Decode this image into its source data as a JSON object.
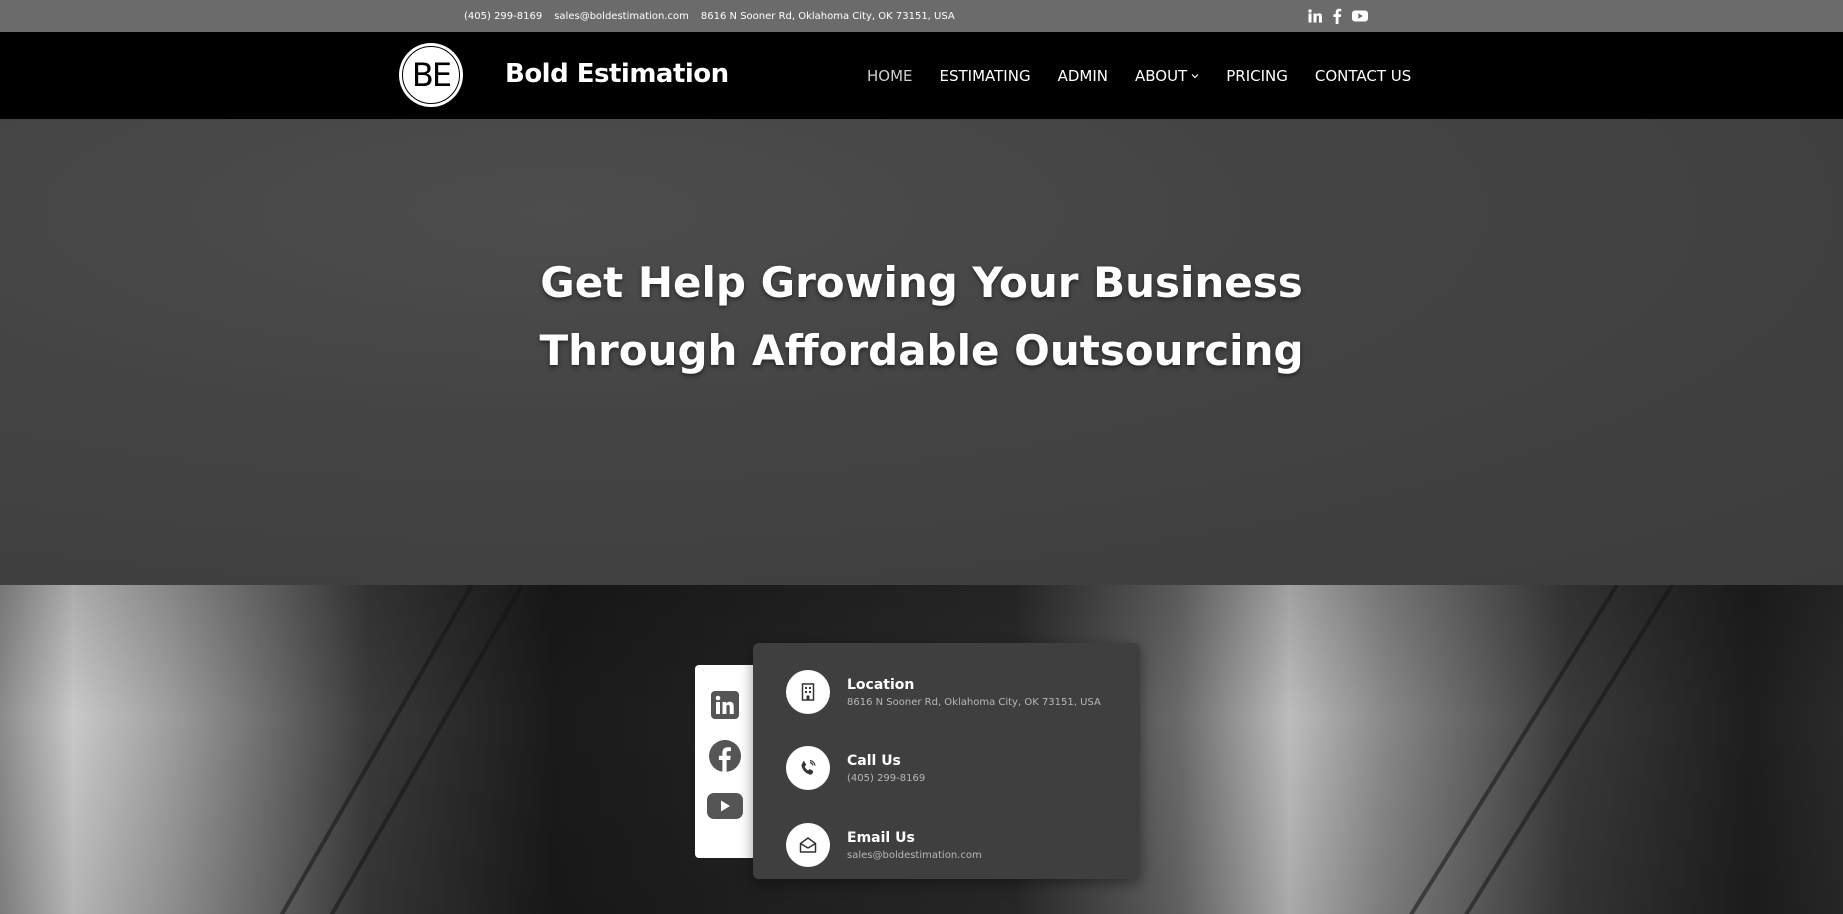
{
  "topbar": {
    "phone": "(405) 299-8169",
    "email": "sales@boldestimation.com",
    "address": "8616 N Sooner Rd, Oklahoma City, OK 73151, USA",
    "socials": [
      "linkedin-icon",
      "facebook-icon",
      "youtube-icon"
    ]
  },
  "header": {
    "logo_text": "BE",
    "brand": "Bold Estimation",
    "nav": [
      {
        "label": "HOME",
        "active": true
      },
      {
        "label": "ESTIMATING"
      },
      {
        "label": "ADMIN"
      },
      {
        "label": "ABOUT",
        "has_dropdown": true
      },
      {
        "label": "PRICING"
      },
      {
        "label": "CONTACT US"
      }
    ]
  },
  "hero": {
    "title_line1": "Get Help Growing Your Business",
    "title_line2": "Through Affordable Outsourcing"
  },
  "info": {
    "location": {
      "title": "Location",
      "value": "8616 N Sooner Rd, Oklahoma City, OK 73151, USA",
      "icon": "building-icon"
    },
    "call": {
      "title": "Call Us",
      "value": "(405) 299-8169",
      "icon": "phone-icon"
    },
    "email": {
      "title": "Email Us",
      "value": "sales@boldestimation.com",
      "icon": "envelope-open-icon"
    }
  },
  "colors": {
    "topbar": "#6b6b6b",
    "header": "#000000",
    "hero": "#444444",
    "card": "#3f3f3f",
    "icon": "#555555"
  }
}
